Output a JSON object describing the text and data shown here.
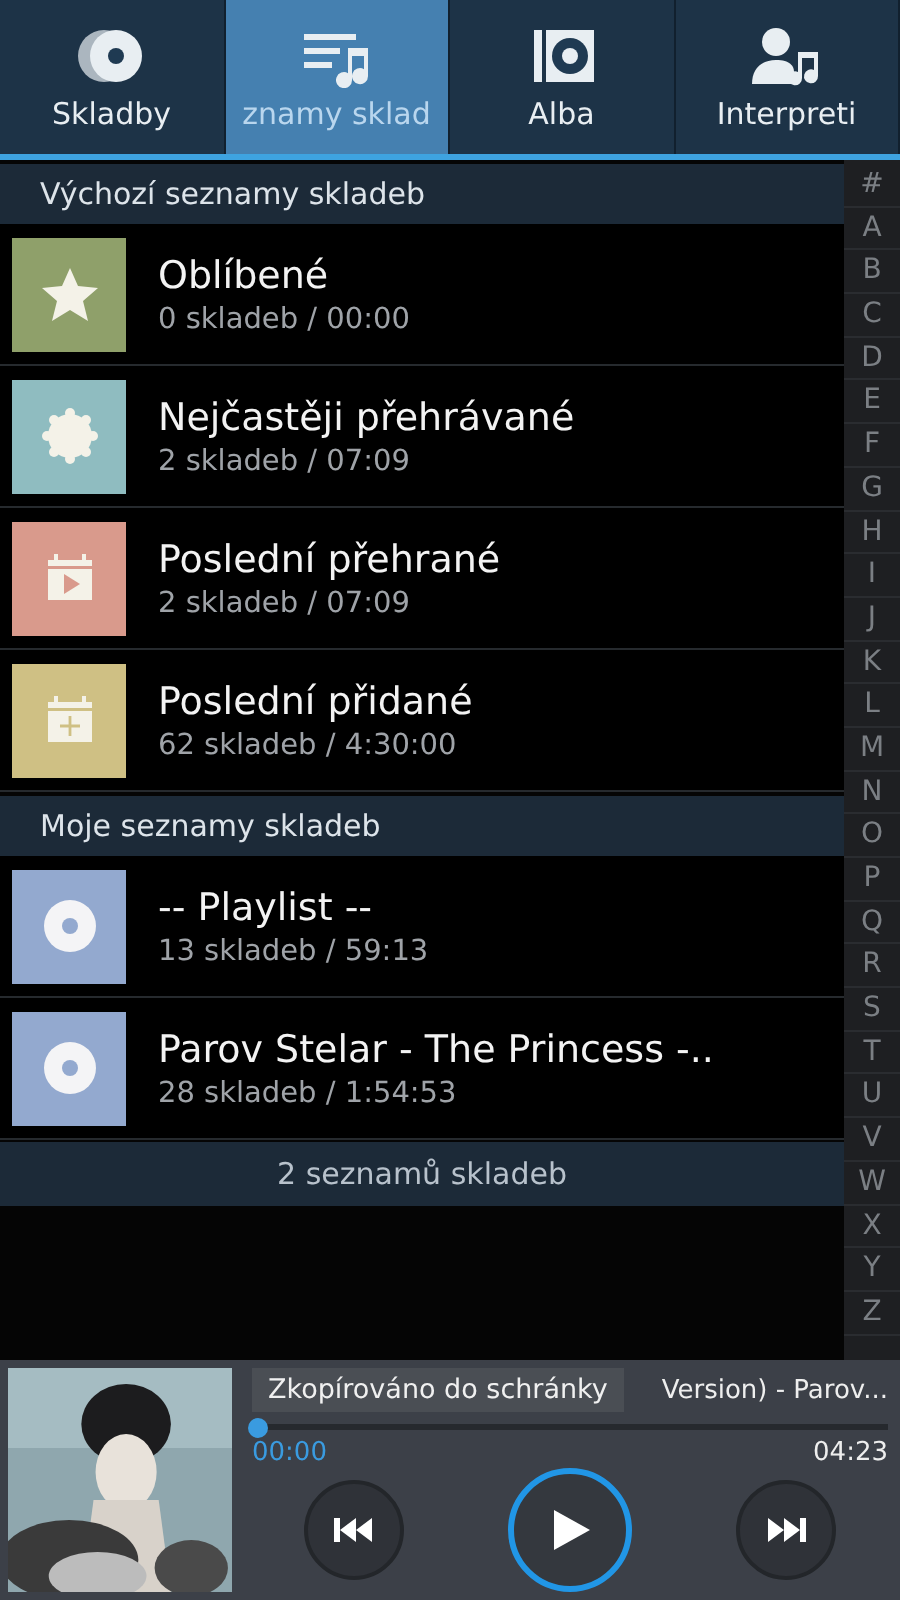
{
  "tabs": [
    {
      "label": "Skladby",
      "kind": "disc",
      "selected": false
    },
    {
      "label": "znamy sklad",
      "kind": "playlist",
      "selected": true
    },
    {
      "label": "Alba",
      "kind": "album",
      "selected": false
    },
    {
      "label": "Interpreti",
      "kind": "artist",
      "selected": false
    }
  ],
  "sections": [
    {
      "title": "Výchozí seznamy skladeb",
      "items": [
        {
          "title": "Oblíbené",
          "subtitle": "0 skladeb / 00:00",
          "kind": "star",
          "color": "#8fa06a"
        },
        {
          "title": "Nejčastěji přehrávané",
          "subtitle": "2 skladeb / 07:09",
          "kind": "badge",
          "color": "#8fbcc0"
        },
        {
          "title": "Poslední přehrané",
          "subtitle": "2 skladeb / 07:09",
          "kind": "calendar-play",
          "color": "#d99a8c"
        },
        {
          "title": "Poslední přidané",
          "subtitle": "62 skladeb / 4:30:00",
          "kind": "calendar-plus",
          "color": "#cfc084"
        }
      ]
    },
    {
      "title": "Moje seznamy skladeb",
      "items": [
        {
          "title": "-- Playlist --",
          "subtitle": "13 skladeb / 59:13",
          "kind": "disc",
          "color": "#93a9cf"
        },
        {
          "title": "Parov Stelar - The Princess -..",
          "subtitle": "28 skladeb / 1:54:53",
          "kind": "disc",
          "color": "#93a9cf"
        }
      ]
    }
  ],
  "footer": "2 seznamů skladeb",
  "index": [
    "#",
    "A",
    "B",
    "C",
    "D",
    "E",
    "F",
    "G",
    "H",
    "I",
    "J",
    "K",
    "L",
    "M",
    "N",
    "O",
    "P",
    "Q",
    "R",
    "S",
    "T",
    "U",
    "V",
    "W",
    "X",
    "Y",
    "Z"
  ],
  "player": {
    "track_title": "Version) - Parov...",
    "level": 0,
    "elapsed": "00:00",
    "total": "04:23",
    "playing": false
  },
  "toast": "Zkopírováno do schránky"
}
